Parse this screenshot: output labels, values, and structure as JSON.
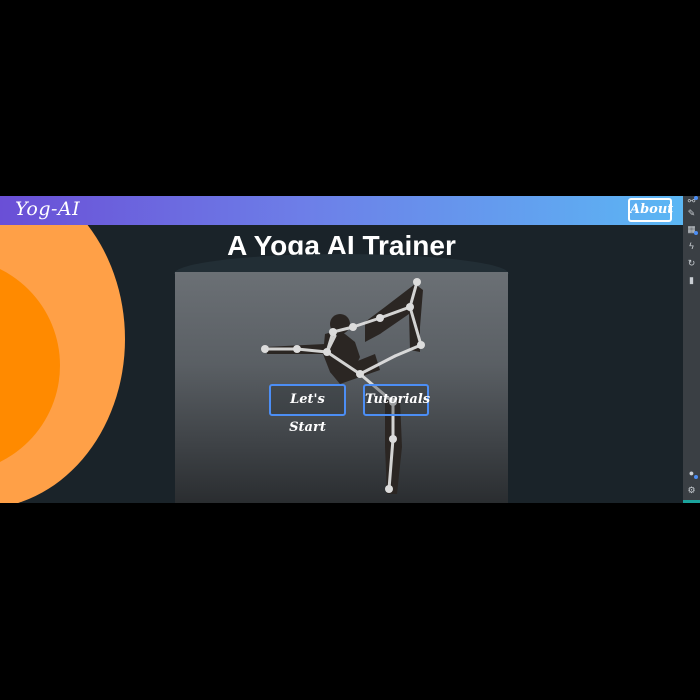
{
  "navbar": {
    "brand": "Yog-AI",
    "about_label": "About"
  },
  "hero": {
    "title": "A Yoga AI Trainer",
    "start_label": "Let's Start",
    "tutorials_label": "Tutorials"
  },
  "colors": {
    "navbar_start": "#6a4fd6",
    "navbar_end": "#5bb7f4",
    "background": "#1a2329",
    "orb_outer": "#ffa047",
    "orb_inner": "#ff8a00",
    "button_border": "#4c8ef5"
  },
  "devtools": {
    "icons": [
      "link-icon",
      "paint-icon",
      "grid-icon",
      "bolt-icon",
      "refresh-icon",
      "chart-icon",
      "settings-icon"
    ]
  }
}
